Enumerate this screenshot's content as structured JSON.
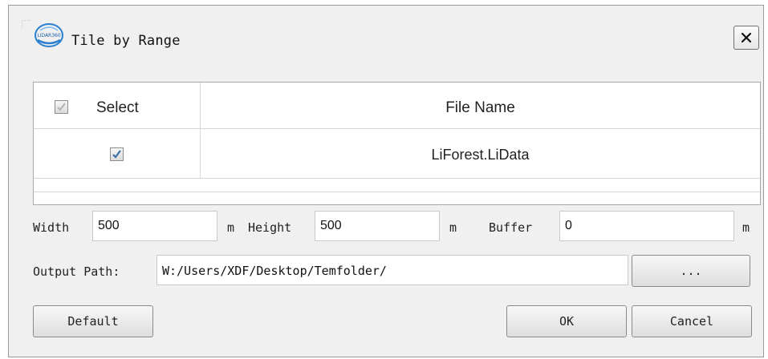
{
  "window": {
    "title": "Tile by Range",
    "logo_text": "LIDAR360"
  },
  "grid": {
    "columns": {
      "select": "Select",
      "file_name": "File Name"
    },
    "rows": [
      {
        "checked": true,
        "file_name": "LiForest.LiData"
      }
    ]
  },
  "params": {
    "width_label": "Width",
    "width_value": "500",
    "width_unit": "m",
    "height_label": "Height",
    "height_value": "500",
    "height_unit": "m",
    "buffer_label": "Buffer",
    "buffer_value": "0",
    "buffer_unit": "m"
  },
  "output": {
    "label": "Output Path:",
    "value": "W:/Users/XDF/Desktop/Temfolder/",
    "browse_label": "..."
  },
  "buttons": {
    "default": "Default",
    "ok": "OK",
    "cancel": "Cancel",
    "close": "✕"
  },
  "icons": {
    "close": "close-icon",
    "check": "checkmark-icon",
    "logo": "app-logo-icon"
  },
  "colors": {
    "check": "#3a6ea5",
    "window_bg": "#f0f0f0"
  }
}
